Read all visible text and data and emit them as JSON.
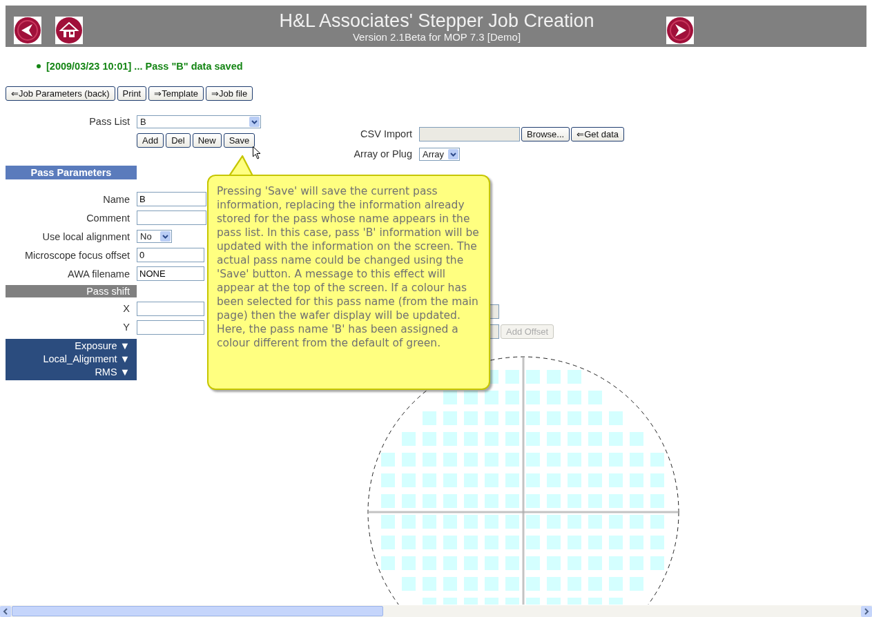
{
  "header": {
    "title": "H&L Associates' Stepper Job Creation",
    "subtitle": "Version 2.1Beta for MOP 7.3   [Demo]"
  },
  "messages": [
    "[2009/03/23 10:01] ... Pass \"B\" data saved"
  ],
  "toolbar_buttons": [
    "⇐Job Parameters (back)",
    "Print",
    "⇒Template",
    "⇒Job file"
  ],
  "pass_list": {
    "label": "Pass List",
    "value": "B",
    "buttons": [
      "Add",
      "Del",
      "New",
      "Save"
    ]
  },
  "pass_parameters": {
    "heading": "Pass Parameters",
    "fields": [
      {
        "label": "Name",
        "value": "B",
        "kind": "wide"
      },
      {
        "label": "Comment",
        "kind": "wide"
      },
      {
        "label": "Use local alignment",
        "value": "No",
        "kind": "select"
      },
      {
        "label": "Microscope focus offset",
        "value": "0",
        "kind": "text"
      },
      {
        "label": "AWA filename",
        "value": "NONE",
        "kind": "text"
      }
    ],
    "pass_shift": {
      "heading": "Pass shift",
      "fields": [
        {
          "label": "X"
        },
        {
          "label": "Y"
        }
      ]
    },
    "sections": [
      "Exposure ▼",
      "Local_Alignment ▼",
      "RMS ▼"
    ]
  },
  "import_panel": {
    "csv_label": "CSV Import",
    "browse_button": "Browse...",
    "get_data_button": "⇐Get data",
    "array_label": "Array or Plug",
    "array_value": "Array",
    "add_offset": {
      "label": "Add Offset",
      "disabled": true
    }
  },
  "tooltip": {
    "text": "Pressing 'Save' will save the current pass information, replacing the information already stored for the pass whose name appears in the pass list. In this case, pass 'B' information will be updated with the information on the screen. The actual pass name could be changed using the 'Save' button. A message to this effect will appear at the top of the screen. If a colour has been selected for this pass name (from the main page) then the wafer display will be updated. Here, the pass name 'B' has been assigned a colour different from the default of green."
  }
}
